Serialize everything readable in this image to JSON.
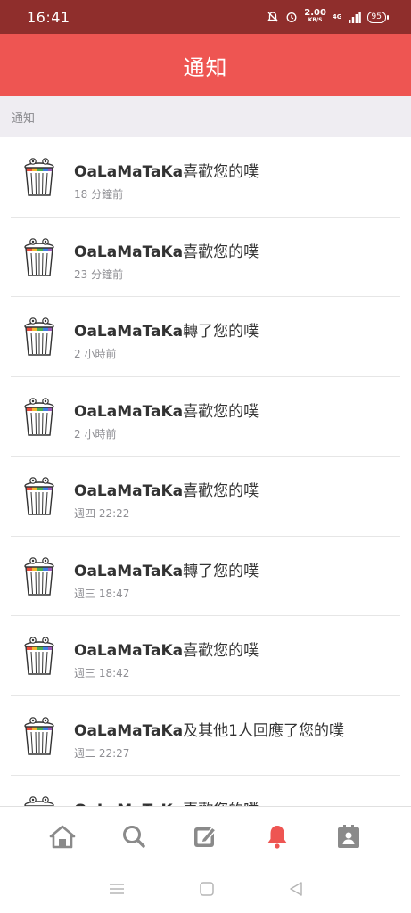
{
  "status_bar": {
    "time": "16:41",
    "net_speed_value": "2.00",
    "net_speed_unit": "KB/S",
    "network_type": "4G",
    "battery": "95"
  },
  "header": {
    "title": "通知"
  },
  "section": {
    "label": "通知"
  },
  "notifications": [
    {
      "user": "OaLaMaTaKa",
      "action": "喜歡您的噗",
      "time": "18 分鐘前"
    },
    {
      "user": "OaLaMaTaKa",
      "action": "喜歡您的噗",
      "time": "23 分鐘前"
    },
    {
      "user": "OaLaMaTaKa",
      "action": "轉了您的噗",
      "time": "2 小時前"
    },
    {
      "user": "OaLaMaTaKa",
      "action": "喜歡您的噗",
      "time": "2 小時前"
    },
    {
      "user": "OaLaMaTaKa",
      "action": "喜歡您的噗",
      "time": "週四 22:22"
    },
    {
      "user": "OaLaMaTaKa",
      "action": "轉了您的噗",
      "time": "週三 18:47"
    },
    {
      "user": "OaLaMaTaKa",
      "action": "喜歡您的噗",
      "time": "週三 18:42"
    },
    {
      "user": "OaLaMaTaKa",
      "action": "及其他1人回應了您的噗",
      "time": "週二 22:27"
    },
    {
      "user": "OaLaMaTaKa",
      "action": "喜歡您的噗",
      "time": ""
    }
  ],
  "tabs": [
    {
      "name": "home-icon",
      "active": false
    },
    {
      "name": "search-icon",
      "active": false
    },
    {
      "name": "compose-icon",
      "active": false
    },
    {
      "name": "bell-icon",
      "active": true
    },
    {
      "name": "profile-card-icon",
      "active": false
    }
  ],
  "colors": {
    "status_bar": "#8f2e2c",
    "header": "#ee5552",
    "active_tab": "#ee5552",
    "inactive_tab": "#8a8a8a"
  }
}
